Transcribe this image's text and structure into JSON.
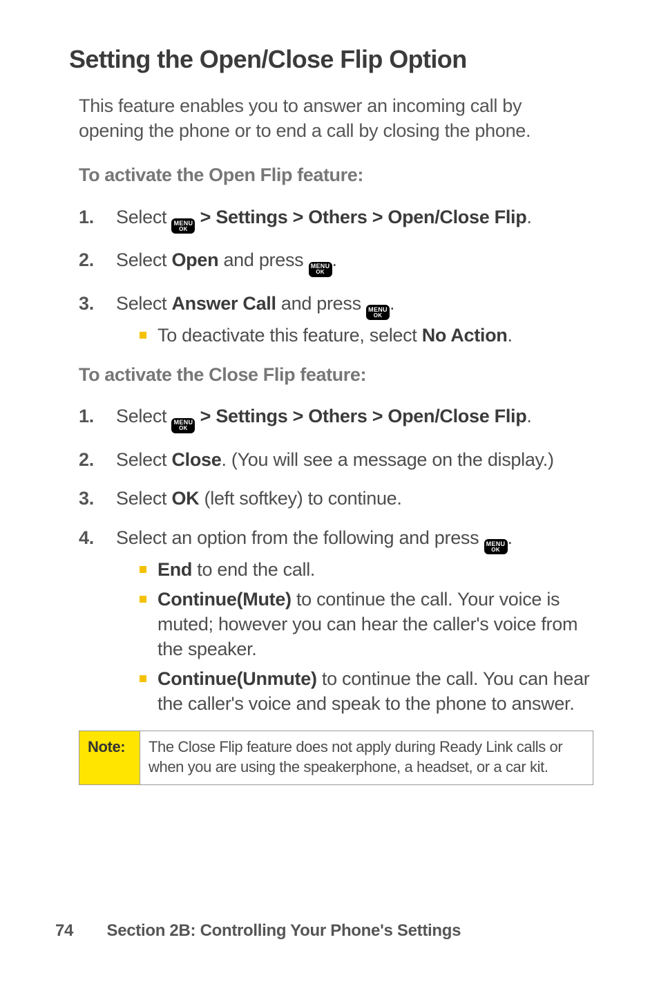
{
  "heading": "Setting the Open/Close Flip Option",
  "intro": "This feature enables you to answer an incoming call by opening the phone or to end a call by closing the phone.",
  "open_subhead": "To activate the Open Flip feature:",
  "close_subhead": "To activate the Close Flip feature:",
  "select_text": "Select ",
  "settings_path_text": " > Settings > Others > Open/Close Flip",
  "period": ".",
  "open_label": "Open",
  "and_press_text": " and press ",
  "answer_call": "Answer Call",
  "deactivate_prefix": "To deactivate this feature, select ",
  "no_action": "No Action",
  "close_label": "Close",
  "close_tail": ". (You will see a message on the display.)",
  "ok_label": "OK",
  "ok_tail": " (left softkey) to continue.",
  "step4_text": "Select an option from the following and press ",
  "end_label": "End",
  "end_tail": " to end the call.",
  "continue_mute": "Continue(Mute)",
  "continue_mute_tail": " to continue the call. Your voice is muted; however you can hear the caller's voice from the speaker.",
  "continue_unmute": "Continue(Unmute)",
  "continue_unmute_tail": " to continue the call. You can hear the caller's voice and speak to the phone to answer.",
  "note_label": "Note:",
  "note_text": "The Close Flip feature does not apply during Ready Link calls or when you are using the speakerphone, a headset, or a car kit.",
  "page_number": "74",
  "footer_text": "Section 2B: Controlling Your Phone's Settings",
  "key_line1": "MENU",
  "key_line2": "OK"
}
